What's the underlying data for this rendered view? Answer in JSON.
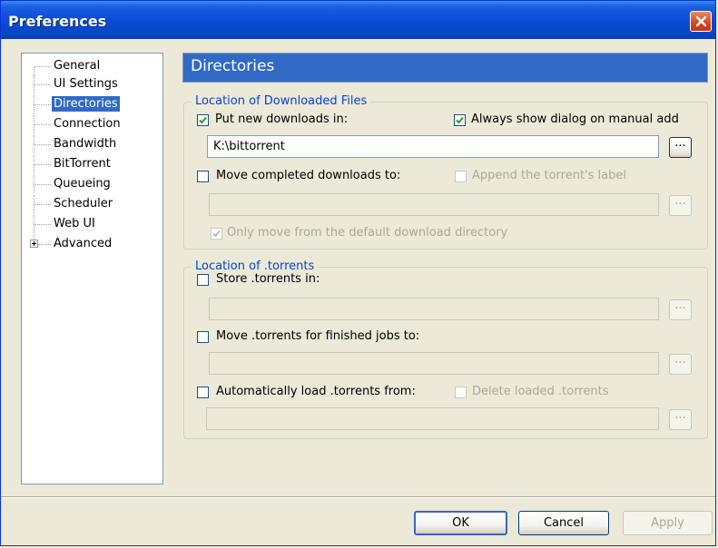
{
  "window": {
    "title": "Preferences"
  },
  "tree": {
    "items": [
      {
        "label": "General"
      },
      {
        "label": "UI Settings"
      },
      {
        "label": "Directories"
      },
      {
        "label": "Connection"
      },
      {
        "label": "Bandwidth"
      },
      {
        "label": "BitTorrent"
      },
      {
        "label": "Queueing"
      },
      {
        "label": "Scheduler"
      },
      {
        "label": "Web UI"
      },
      {
        "label": "Advanced"
      }
    ],
    "selected": "Directories"
  },
  "panel": {
    "header": "Directories",
    "downloaded": {
      "label": "Location of Downloaded Files",
      "put_new": {
        "label": "Put new downloads in:",
        "checked": true
      },
      "always_show": {
        "label": "Always show dialog on manual add",
        "checked": true
      },
      "download_path": "K:\\bittorrent",
      "move_completed": {
        "label": "Move completed downloads to:",
        "checked": false
      },
      "append_label": {
        "label": "Append the torrent's label",
        "checked": false
      },
      "completed_path": "",
      "only_move": {
        "label": "Only move from the default download directory",
        "checked": true
      }
    },
    "torrents": {
      "label": "Location of .torrents",
      "store": {
        "label": "Store .torrents in:",
        "checked": false
      },
      "store_path": "",
      "move_finished": {
        "label": "Move .torrents for finished jobs to:",
        "checked": false
      },
      "finished_path": "",
      "autoload": {
        "label": "Automatically load .torrents from:",
        "checked": false
      },
      "delete_loaded": {
        "label": "Delete loaded .torrents",
        "checked": false
      },
      "autoload_path": ""
    },
    "browse_label": "..."
  },
  "buttons": {
    "ok": "OK",
    "cancel": "Cancel",
    "apply": "Apply"
  },
  "colors": {
    "titlebar": "#0a4cd6",
    "selection": "#316ac5",
    "group_label": "#0046d5"
  }
}
